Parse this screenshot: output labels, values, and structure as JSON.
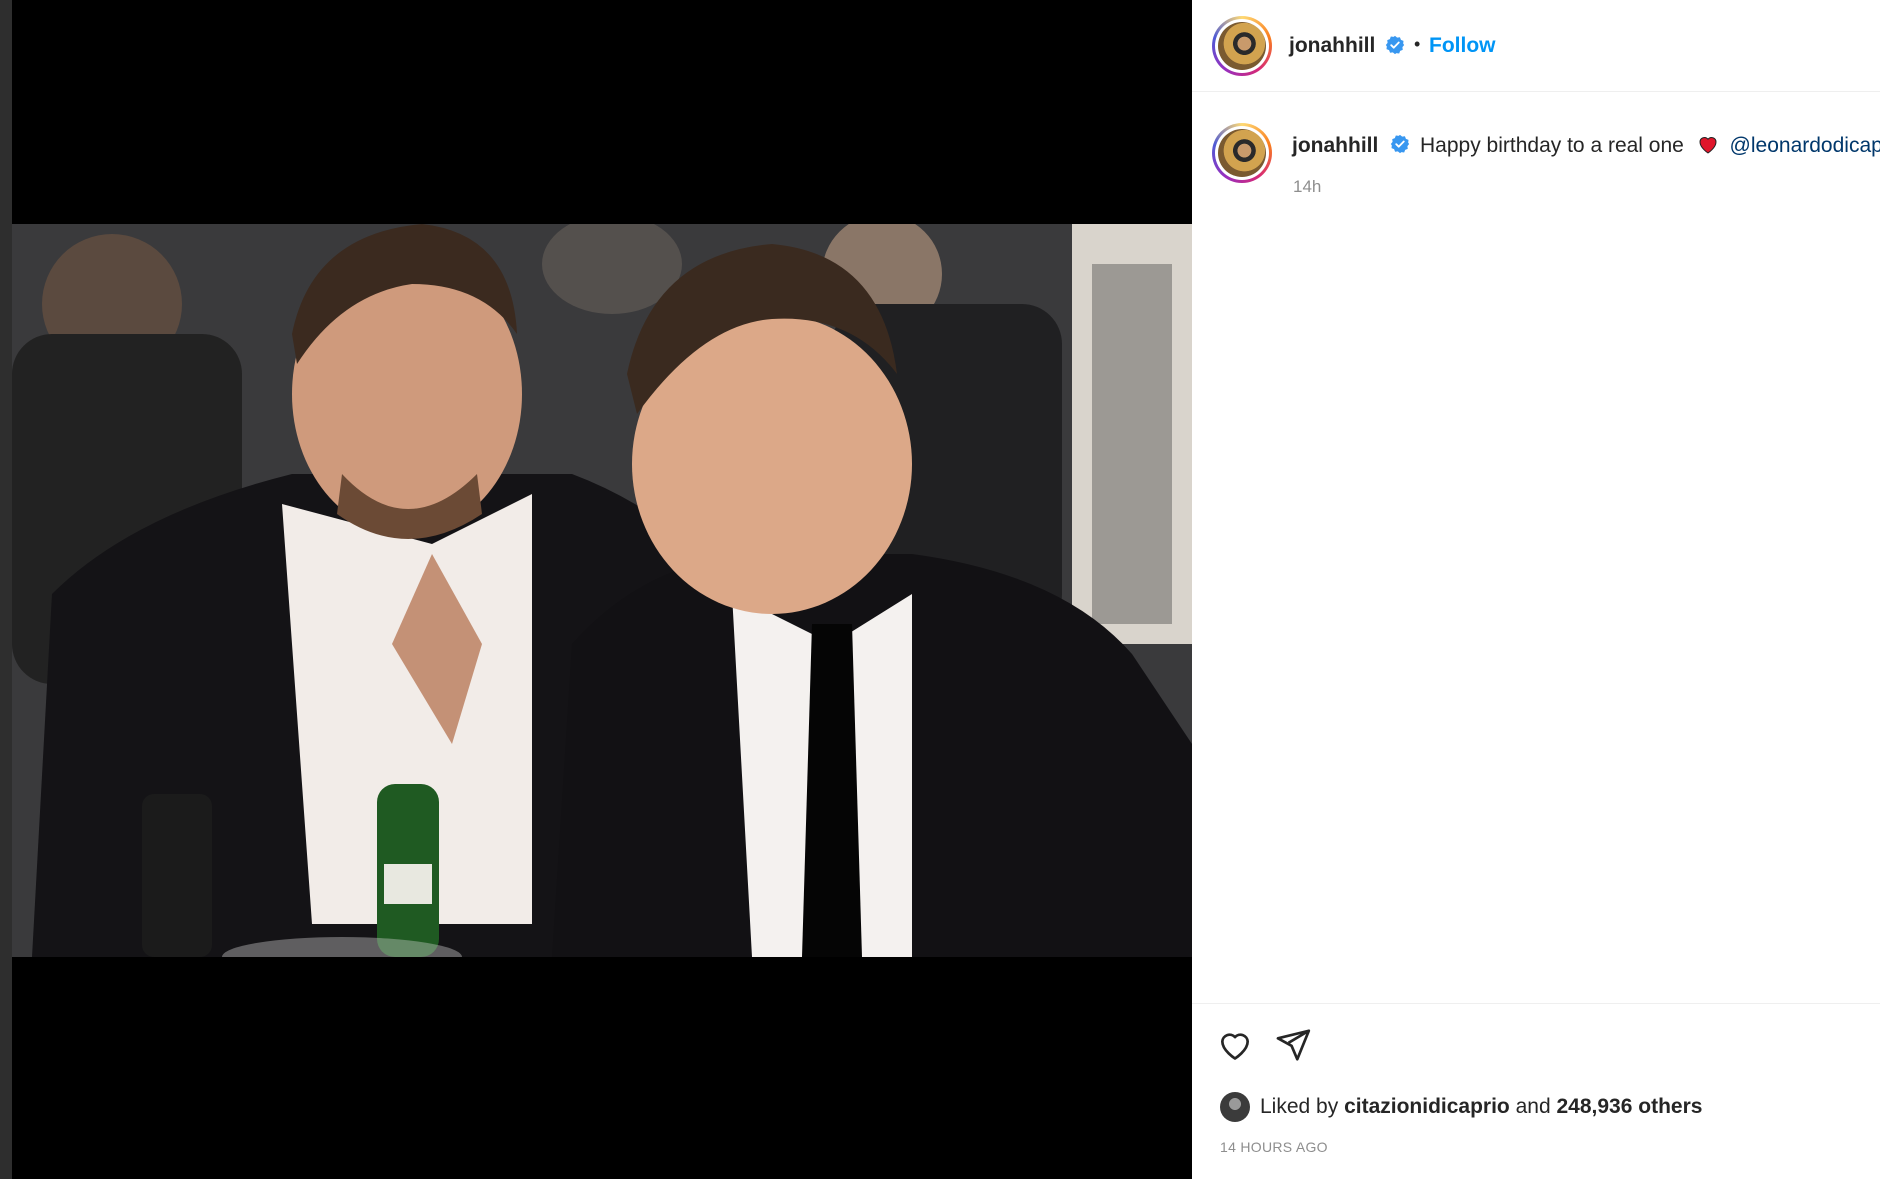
{
  "post": {
    "username": "jonahhill",
    "follow_label": "Follow",
    "dot": "•",
    "caption": {
      "username": "jonahhill",
      "text": "Happy birthday to a real one",
      "mention": "@leonardodicaprio"
    },
    "caption_timestamp": "14h",
    "likes": {
      "prefix": "Liked by",
      "liker": "citazionidicaprio",
      "and": "and",
      "count": "248,936 others"
    },
    "time_ago": "14 HOURS AGO"
  },
  "colors": {
    "link": "#0095f6",
    "mention": "#00376b",
    "heart_emoji": "#e0162b",
    "verified": "#3897f0"
  },
  "icons": [
    "verified-badge-icon",
    "heart-emoji-icon",
    "like-heart-icon",
    "share-send-icon"
  ]
}
